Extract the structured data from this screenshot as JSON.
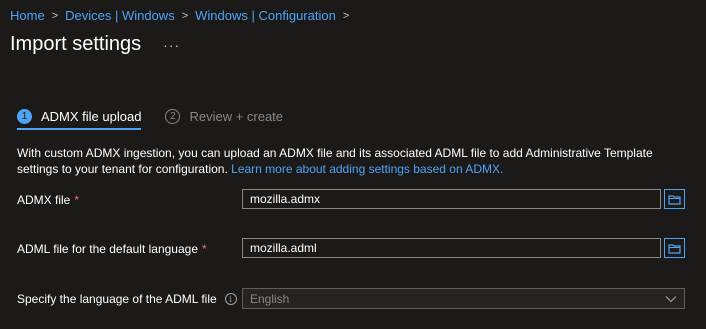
{
  "breadcrumb": {
    "items": [
      "Home",
      "Devices | Windows",
      "Windows | Configuration"
    ],
    "separator": ">"
  },
  "page": {
    "title": "Import settings",
    "more": "···"
  },
  "steps": [
    {
      "number": "1",
      "label": "ADMX file upload",
      "state": "active"
    },
    {
      "number": "2",
      "label": "Review + create",
      "state": "inactive"
    }
  ],
  "description": {
    "text": "With custom ADMX ingestion, you can upload an ADMX file and its associated ADML file to add Administrative Template settings to your tenant for configuration.",
    "link": "Learn more about adding settings based on ADMX."
  },
  "fields": {
    "admx": {
      "label": "ADMX file",
      "required_mark": "*",
      "value": "mozilla.admx"
    },
    "adml": {
      "label": "ADML file for the default language",
      "required_mark": "*",
      "value": "mozilla.adml"
    },
    "language": {
      "label": "Specify the language of the ADML file",
      "info": "i",
      "value": "English"
    }
  },
  "icons": {
    "browse": "folder-icon",
    "dropdown": "chevron-down-icon",
    "info": "info-icon"
  },
  "colors": {
    "accent": "#4fa3f7",
    "background": "#1b1a19",
    "required": "#f1707b"
  }
}
